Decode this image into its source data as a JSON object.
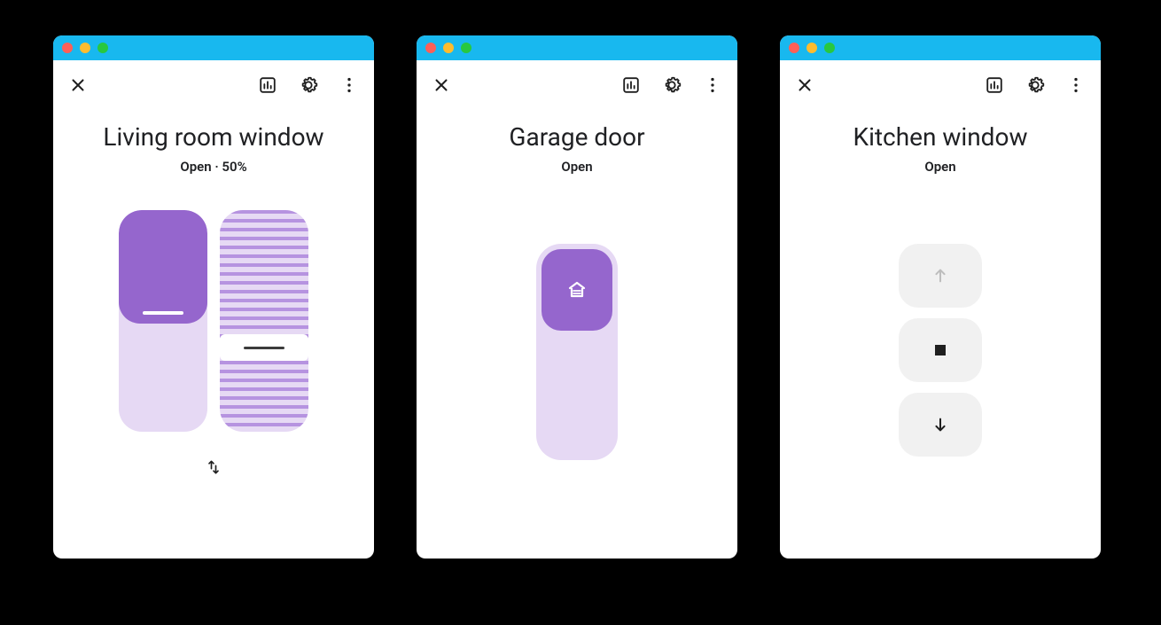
{
  "panels": [
    {
      "title": "Living room window",
      "status": "Open · 50%",
      "position_pct": 50,
      "tilt_pct": 56
    },
    {
      "title": "Garage door",
      "status": "Open"
    },
    {
      "title": "Kitchen window",
      "status": "Open"
    }
  ],
  "colors": {
    "accent": "#9566cd",
    "accent_light": "#e6d9f4",
    "titlebar": "#18b8ef"
  },
  "icons": {
    "close": "close-icon",
    "bar_chart": "bar-chart-icon",
    "settings": "gear-icon",
    "overflow": "more-vert-icon",
    "swap": "swap-vert-icon",
    "garage": "garage-icon",
    "arrow_up": "arrow-up-icon",
    "stop": "stop-icon",
    "arrow_down": "arrow-down-icon"
  }
}
